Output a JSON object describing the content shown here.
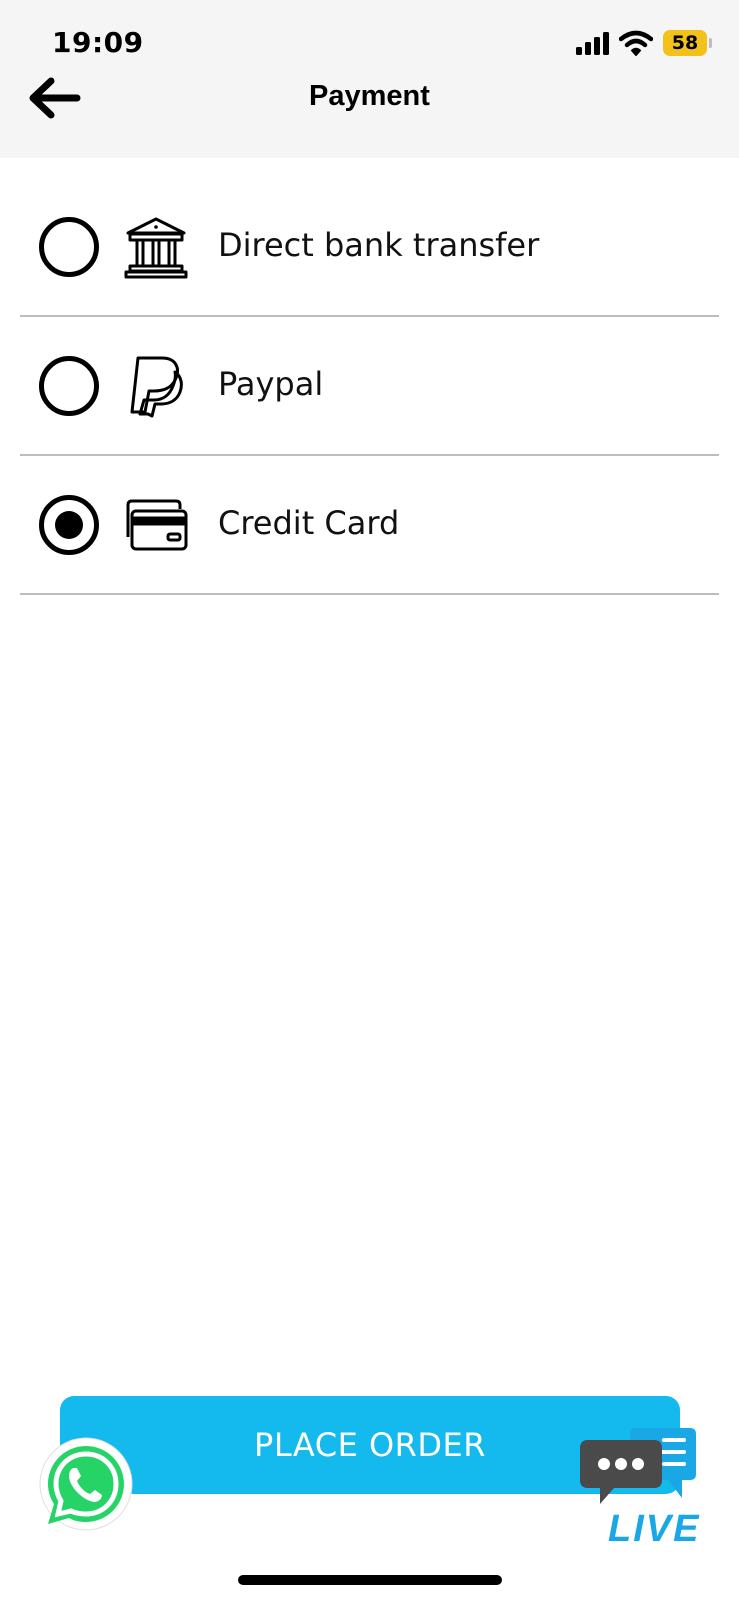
{
  "status_bar": {
    "time": "19:09",
    "battery": "58",
    "signal_icon": "cellular-signal-icon",
    "wifi_icon": "wifi-icon"
  },
  "header": {
    "title": "Payment",
    "back_icon": "arrow-left-icon"
  },
  "payment_methods": [
    {
      "label": "Direct bank transfer",
      "icon": "bank-icon",
      "selected": false
    },
    {
      "label": "Paypal",
      "icon": "paypal-icon",
      "selected": false
    },
    {
      "label": "Credit Card",
      "icon": "credit-card-icon",
      "selected": true
    }
  ],
  "actions": {
    "place_order_label": "PLACE ORDER"
  },
  "chat_widgets": {
    "whatsapp_icon": "whatsapp-icon",
    "live_chat_icon": "live-chat-icon",
    "live_label": "LIVE"
  },
  "colors": {
    "accent": "#14b9ee",
    "live_blue": "#1aa7e5",
    "whatsapp_green": "#25d366",
    "battery_yellow": "#f2c21a",
    "header_bg": "#f5f5f5",
    "divider": "#bdbdbd"
  }
}
